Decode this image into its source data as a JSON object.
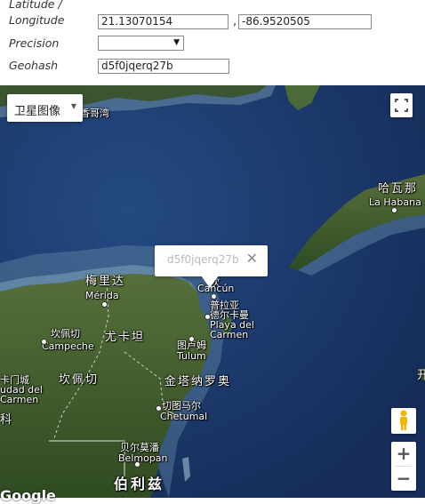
{
  "form": {
    "latlng_label_line1": "Latitude /",
    "latlng_label_line2": "Longitude",
    "latitude_value": "21.13070154",
    "separator": ",",
    "longitude_value": "-86.9520505",
    "precision_label": "Precision",
    "precision_value": "",
    "geohash_label": "Geohash",
    "geohash_value": "d5f0jqerq27b"
  },
  "map": {
    "map_type_label": "卫星图像",
    "info_window_text": "d5f0jqerq27b",
    "close_symbol": "✕",
    "zoom_in": "+",
    "zoom_out": "−",
    "attribution": "Google",
    "places": {
      "top_edge_text": "香哥湾",
      "havana_cn": "哈瓦那",
      "havana_en": "La Habana",
      "merida_cn": "梅里达",
      "merida_en": "Mérida",
      "cancun_cn": "坎",
      "cancun_en": "Cancún",
      "playa_cn1": "普拉亚",
      "playa_cn2": "德尔卡曼",
      "playa_en1": "Playa del",
      "playa_en2": "Carmen",
      "campeche_cn": "坎佩切",
      "campeche_en": "Campeche",
      "yucatan_cn": "尤卡坦",
      "tulum_cn": "图卢姆",
      "tulum_en": "Tulum",
      "quintana_cn": "金塔纳罗奥",
      "campeche_state_cn": "坎佩切",
      "chetumal_cn": "切图马尔",
      "chetumal_en": "Chetumal",
      "carmen_cn": "卡门城",
      "carmen_en1": "udad del",
      "carmen_en2": "Carmen",
      "left_edge_cn": "科",
      "belmopan_cn": "贝尔莫潘",
      "belmopan_en": "Belmopan",
      "belize_cn": "伯利兹",
      "right_edge_cn": "开"
    }
  },
  "colors": {
    "ocean": "#17305e",
    "land": "#3e5a2e",
    "shallow_water": "#6f90a8"
  }
}
